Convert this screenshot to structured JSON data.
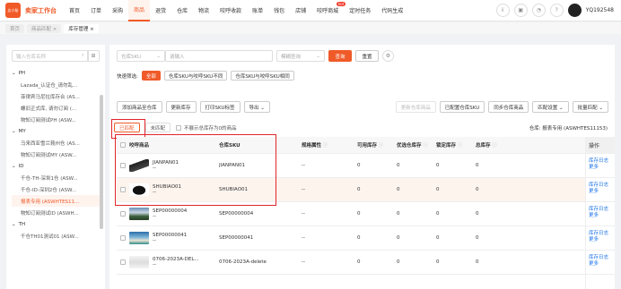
{
  "brand": {
    "logo_text": "店小秘",
    "title": "卖家工作台"
  },
  "nav": [
    {
      "label": "首页"
    },
    {
      "label": "订单"
    },
    {
      "label": "采购"
    },
    {
      "label": "商品",
      "active": true
    },
    {
      "label": "退货"
    },
    {
      "label": "仓库"
    },
    {
      "label": "物流"
    },
    {
      "label": "咬呼收款"
    },
    {
      "label": "账单"
    },
    {
      "label": "钱包"
    },
    {
      "label": "店铺"
    },
    {
      "label": "咬呼商城",
      "badge": "hot"
    },
    {
      "label": "定时任务"
    },
    {
      "label": "代码生成"
    }
  ],
  "user": {
    "name": "YQ192548"
  },
  "tabs": [
    {
      "label": "首页"
    },
    {
      "label": "商品匹配 ×"
    },
    {
      "label": "库存管理 ×",
      "active": true
    }
  ],
  "left": {
    "search_placeholder": "输入仓库名称",
    "groups": [
      {
        "name": "PH",
        "items": [
          "Lazada_认证仓_请勿乱...",
          "菲律宾马尼拉库存合 (AS...",
          "螺旧正式库, 请勿订阅 (...",
          "物知订阅测试PH (ASW..."
        ]
      },
      {
        "name": "MY",
        "items": [
          "马来西亚雪兰莪州仓 (AS...",
          "物知订阅测试MY (ASW..."
        ]
      },
      {
        "name": "ID",
        "items": [
          "千仓-TH-深圳1仓 (ASW...",
          "千仓-ID-深圳2仓 (ASW...",
          "报表专用 (ASWHTES11...",
          "物知订阅测试ID (ASWH..."
        ]
      },
      {
        "name": "TH",
        "items": [
          "千仓TH01测试01 (ASW..."
        ]
      }
    ],
    "active_item": "报表专用 (ASWHTES11..."
  },
  "filters": {
    "sku_select": "仓库SKU",
    "sku_placeholder": "请输入",
    "match_select": "模糊查询",
    "search_label": "查询",
    "reset_label": "重置"
  },
  "quick": {
    "label": "快速筛选:",
    "tags": [
      {
        "label": "全部",
        "on": true
      },
      {
        "label": "仓库SKU与咬呼SKU不同"
      },
      {
        "label": "仓库SKU与咬呼SKU相同"
      }
    ]
  },
  "toolbar": {
    "left": [
      "添加商品至仓库",
      "更新库存",
      "打印SKU标签",
      "导出 ⌄"
    ],
    "right": [
      "更新仓库商品",
      "已配置仓库SKU",
      "同步仓库商品",
      "匹配设置 ⌄",
      "批量匹配 ⌄"
    ]
  },
  "subtabs": {
    "matched": "已匹配",
    "unmatched": "未匹配",
    "hide_zero": "不展示总库存为0的商品"
  },
  "warehouse_label": "仓库: 报表专用 (ASWHTES11153)",
  "table": {
    "headers": [
      "咬呼商品",
      "仓库SKU",
      "规格属性",
      "可用库存",
      "优选仓库存",
      "锁定库存",
      "总库存",
      "操作"
    ],
    "rows": [
      {
        "product": "JIANPAN01",
        "sub": "--",
        "sku": "JIANPAN01",
        "spec": "--",
        "avail": "0",
        "pref": "0",
        "lock": "0",
        "total": "0",
        "thumb": "keyboard"
      },
      {
        "product": "SHUBIAO01",
        "sub": "--",
        "sku": "SHUBIAO01",
        "spec": "--",
        "avail": "0",
        "pref": "0",
        "lock": "0",
        "total": "0",
        "thumb": "mouse",
        "highlight": true
      },
      {
        "product": "SEP00000004",
        "sub": "--",
        "sku": "SEP00000004",
        "spec": "--",
        "avail": "0",
        "pref": "0",
        "lock": "0",
        "total": "0",
        "thumb": "landscape1"
      },
      {
        "product": "SEP00000041",
        "sub": "--",
        "sku": "SEP00000041",
        "spec": "--",
        "avail": "0",
        "pref": "0",
        "lock": "0",
        "total": "0",
        "thumb": "landscape2"
      },
      {
        "product": "0706-2023A-DEL...",
        "sub": "--",
        "sku": "0706-2023A-delete",
        "spec": "--",
        "avail": "0",
        "pref": "0",
        "lock": "0",
        "total": "0",
        "thumb": "document"
      }
    ],
    "op_labels": [
      "库存日志",
      "更多"
    ]
  }
}
